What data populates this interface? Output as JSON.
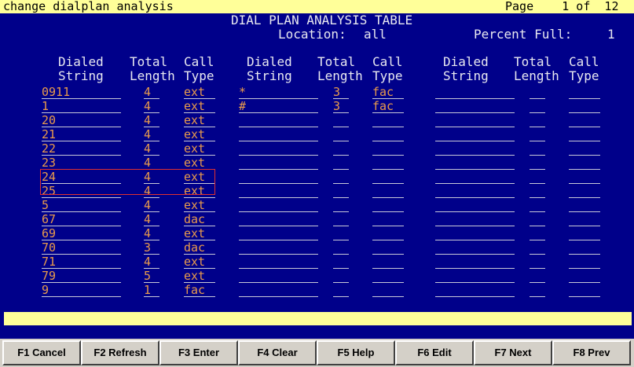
{
  "command": "change dialplan analysis",
  "page_info": "Page    1 of  12",
  "table": {
    "title": "DIAL PLAN ANALYSIS TABLE",
    "location_label": "Location:",
    "location_value": "all",
    "percent_label": "Percent Full:",
    "percent_value": "1"
  },
  "headers": {
    "dialed_1": "Dialed",
    "dialed_2": "String",
    "total_1": "Total",
    "total_2": "Length",
    "call_1": "Call",
    "call_2": "Type"
  },
  "columns": [
    {
      "rows": [
        {
          "string": "0911",
          "length": "4",
          "type": "ext"
        },
        {
          "string": "1",
          "length": "4",
          "type": "ext"
        },
        {
          "string": "20",
          "length": "4",
          "type": "ext"
        },
        {
          "string": "21",
          "length": "4",
          "type": "ext"
        },
        {
          "string": "22",
          "length": "4",
          "type": "ext"
        },
        {
          "string": "23",
          "length": "4",
          "type": "ext"
        },
        {
          "string": "24",
          "length": "4",
          "type": "ext"
        },
        {
          "string": "25",
          "length": "4",
          "type": "ext"
        },
        {
          "string": "5",
          "length": "4",
          "type": "ext"
        },
        {
          "string": "67",
          "length": "4",
          "type": "dac"
        },
        {
          "string": "69",
          "length": "4",
          "type": "ext"
        },
        {
          "string": "70",
          "length": "3",
          "type": "dac"
        },
        {
          "string": "71",
          "length": "4",
          "type": "ext"
        },
        {
          "string": "79",
          "length": "5",
          "type": "ext"
        },
        {
          "string": "9",
          "length": "1",
          "type": "fac"
        }
      ]
    },
    {
      "rows": [
        {
          "string": "*",
          "length": "3",
          "type": "fac"
        },
        {
          "string": "#",
          "length": "3",
          "type": "fac"
        },
        {
          "string": "",
          "length": "",
          "type": ""
        },
        {
          "string": "",
          "length": "",
          "type": ""
        },
        {
          "string": "",
          "length": "",
          "type": ""
        },
        {
          "string": "",
          "length": "",
          "type": ""
        },
        {
          "string": "",
          "length": "",
          "type": ""
        },
        {
          "string": "",
          "length": "",
          "type": ""
        },
        {
          "string": "",
          "length": "",
          "type": ""
        },
        {
          "string": "",
          "length": "",
          "type": ""
        },
        {
          "string": "",
          "length": "",
          "type": ""
        },
        {
          "string": "",
          "length": "",
          "type": ""
        },
        {
          "string": "",
          "length": "",
          "type": ""
        },
        {
          "string": "",
          "length": "",
          "type": ""
        },
        {
          "string": "",
          "length": "",
          "type": ""
        }
      ]
    },
    {
      "rows": [
        {
          "string": "",
          "length": "",
          "type": ""
        },
        {
          "string": "",
          "length": "",
          "type": ""
        },
        {
          "string": "",
          "length": "",
          "type": ""
        },
        {
          "string": "",
          "length": "",
          "type": ""
        },
        {
          "string": "",
          "length": "",
          "type": ""
        },
        {
          "string": "",
          "length": "",
          "type": ""
        },
        {
          "string": "",
          "length": "",
          "type": ""
        },
        {
          "string": "",
          "length": "",
          "type": ""
        },
        {
          "string": "",
          "length": "",
          "type": ""
        },
        {
          "string": "",
          "length": "",
          "type": ""
        },
        {
          "string": "",
          "length": "",
          "type": ""
        },
        {
          "string": "",
          "length": "",
          "type": ""
        },
        {
          "string": "",
          "length": "",
          "type": ""
        },
        {
          "string": "",
          "length": "",
          "type": ""
        },
        {
          "string": "",
          "length": "",
          "type": ""
        }
      ]
    }
  ],
  "fkeys": [
    "F1 Cancel",
    "F2 Refresh",
    "F3 Enter",
    "F4 Clear",
    "F5 Help",
    "F6 Edit",
    "F7 Next",
    "F8 Prev"
  ],
  "colors": {
    "background": "#00008a",
    "field_text": "#e89a4c",
    "label_text": "#e8e8f0",
    "status_bar": "#ffff99",
    "highlight_box": "#e03030"
  }
}
